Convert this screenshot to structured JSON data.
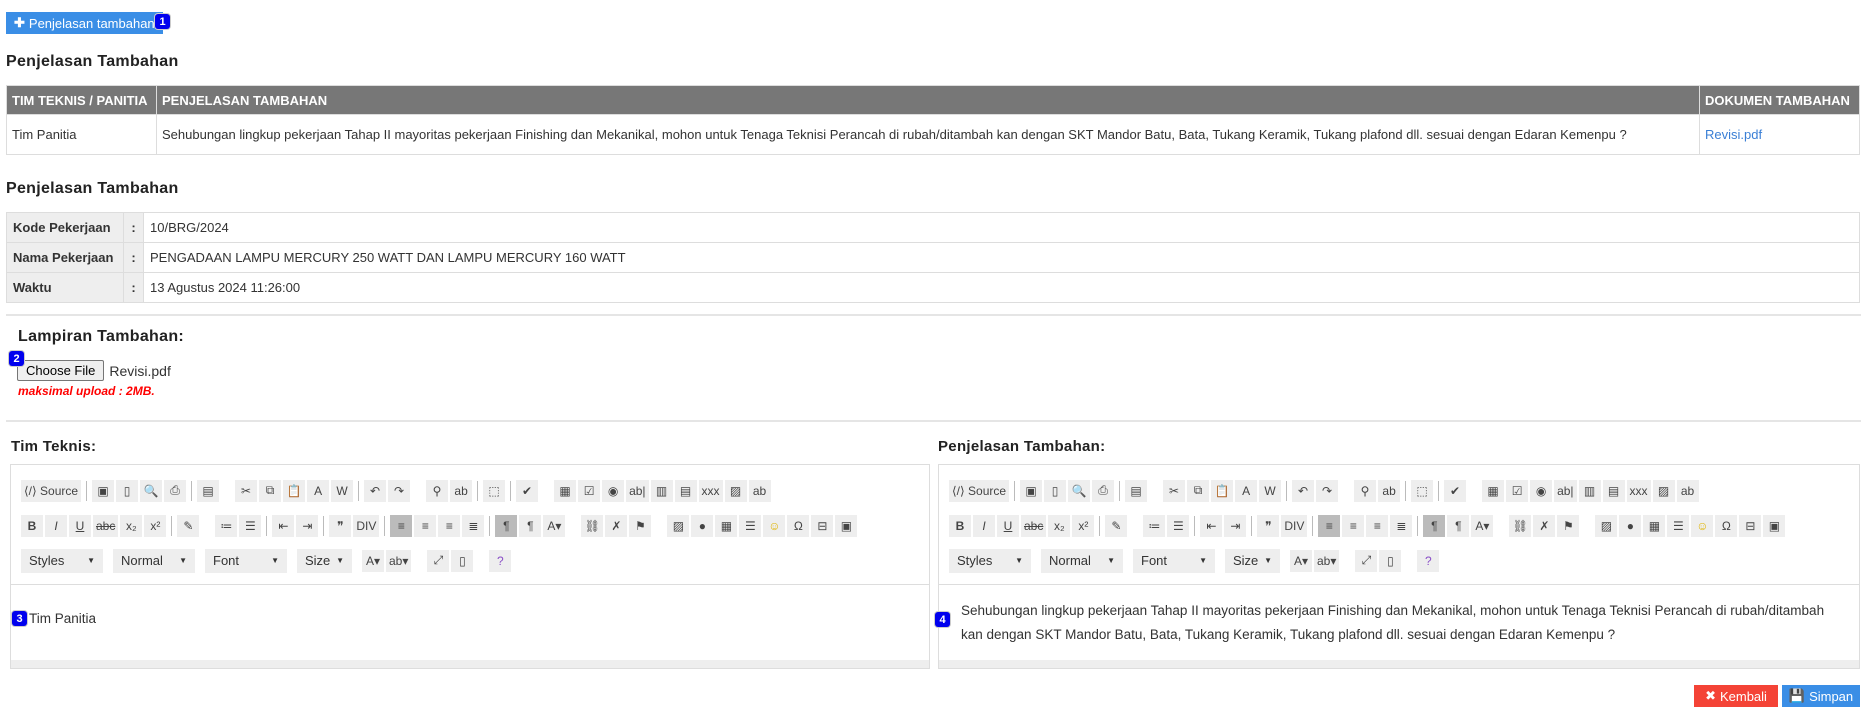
{
  "top": {
    "add_button": "Penjelasan tambahan",
    "badges": [
      "1",
      "2",
      "3",
      "4"
    ]
  },
  "section1": {
    "title": "Penjelasan Tambahan",
    "columns": [
      "TIM TEKNIS / PANITIA",
      "PENJELASAN TAMBAHAN",
      "DOKUMEN TAMBAHAN"
    ],
    "rows": [
      {
        "tim": "Tim Panitia",
        "penjelasan": "Sehubungan lingkup pekerjaan Tahap II mayoritas pekerjaan Finishing dan Mekanikal, mohon untuk Tenaga Teknisi Perancah di rubah/ditambah kan dengan SKT Mandor Batu, Bata, Tukang Keramik, Tukang plafond dll. sesuai dengan Edaran Kemenpu ?",
        "dokumen": "Revisi.pdf"
      }
    ]
  },
  "section2": {
    "title": "Penjelasan Tambahan",
    "colon": ":",
    "rows": [
      {
        "label": "Kode Pekerjaan",
        "value": "10/BRG/2024"
      },
      {
        "label": "Nama Pekerjaan",
        "value": "PENGADAAN LAMPU MERCURY 250 WATT DAN LAMPU MERCURY 160 WATT"
      },
      {
        "label": "Waktu",
        "value": "13 Agustus 2024 11:26:00"
      }
    ]
  },
  "upload": {
    "label": "Lampiran Tambahan:",
    "button": "Choose File",
    "filename": "Revisi.pdf",
    "note": "maksimal upload : 2MB."
  },
  "editors": [
    {
      "label": "Tim Teknis:",
      "content": "Tim Panitia"
    },
    {
      "label": "Penjelasan Tambahan:",
      "content": "Sehubungan lingkup pekerjaan Tahap II mayoritas pekerjaan Finishing dan Mekanikal, mohon untuk Tenaga Teknisi Perancah di rubah/ditambah kan dengan SKT Mandor Batu, Bata, Tukang Keramik, Tukang plafond dll. sesuai dengan Edaran Kemenpu ?"
    }
  ],
  "toolbar": {
    "source_label": "Source",
    "row1": [
      "|",
      "save",
      "new-page",
      "preview",
      "print",
      "|",
      "templates",
      "_",
      "cut",
      "copy",
      "paste",
      "paste-text",
      "paste-word",
      "|",
      "undo",
      "redo",
      "_",
      "find",
      "replace",
      "|",
      "select-all",
      "|",
      "spellcheck",
      "_",
      "form",
      "checkbox",
      "radio",
      "text-field",
      "textarea",
      "select",
      "button",
      "image-button",
      "hidden-field"
    ],
    "row2": [
      "bold",
      "italic",
      "underline",
      "strike",
      "subscript",
      "superscript",
      "|",
      "remove-format",
      "_",
      "numbered-list",
      "bulleted-list",
      "|",
      "outdent",
      "indent",
      "|",
      "blockquote",
      "div",
      "|",
      "align-left",
      "align-center",
      "align-right",
      "justify",
      "|",
      "ltr",
      "rtl",
      "language",
      "_",
      "link",
      "unlink",
      "anchor",
      "_",
      "image",
      "flash",
      "table",
      "horizontal-rule",
      "smiley",
      "special-char",
      "page-break",
      "iframe"
    ],
    "combos": [
      "Styles",
      "Normal",
      "Font",
      "Size"
    ],
    "row3": [
      "text-color",
      "bg-color",
      "_",
      "maximize",
      "show-blocks",
      "_",
      "about"
    ]
  },
  "actions": {
    "back": "Kembali",
    "save": "Simpan"
  },
  "colors": {
    "primary": "#3a8ee6",
    "danger": "#f44336",
    "header": "#777777"
  }
}
